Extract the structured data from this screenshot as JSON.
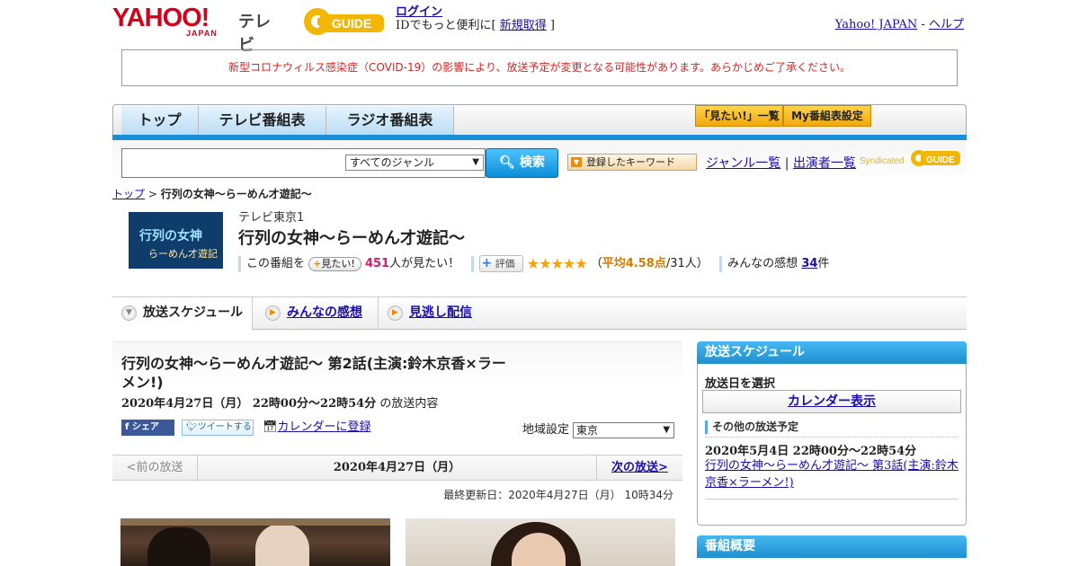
{
  "header": {
    "logo_text": "YAHOO!",
    "logo_sub": "JAPAN",
    "logo_tv": "テレビ",
    "gguide_text": "GUIDE",
    "login_label": "ログイン",
    "id_text_before": "IDでもっと便利に[ ",
    "register_label": "新規取得",
    "id_text_after": " ]",
    "yahoo_japan_link": "Yahoo! JAPAN",
    "separator": " - ",
    "help_link": "ヘルプ"
  },
  "notice": "新型コロナウィルス感染症（COVID-19）の影響により、放送予定が変更となる可能性があります。あらかじめご了承ください。",
  "nav": {
    "tabs": [
      "トップ",
      "テレビ番組表",
      "ラジオ番組表"
    ],
    "mitai_list": "「見たい!」一覧",
    "my_settings": "My番組表設定"
  },
  "search": {
    "genre_selected": "すべてのジャンル",
    "search_button": "検索",
    "keyword_button": "登録したキーワード",
    "genre_list_link": "ジャンル一覧",
    "divider": "|",
    "performer_list_link": "出演者一覧",
    "syndicated_text": "Syndicated",
    "syndicated_logo": "GUIDE"
  },
  "breadcrumb": {
    "top": "トップ",
    "sep": " > ",
    "current": "行列の女神～らーめん才遊記～"
  },
  "program": {
    "image_title": "行列の女神",
    "image_sub": "らーめん才遊記",
    "channel": "テレビ東京1",
    "title": "行列の女神～らーめん才遊記～",
    "want_prefix": "この番組を",
    "want_button": "見たい!",
    "want_count": "451",
    "want_suffix": "人が見たい！",
    "rating_button": "評価",
    "stars": "★★★★★",
    "rating_open": "（",
    "rating_avg": "平均4.58点",
    "rating_count": "/31人）",
    "comments_label": "みんなの感想",
    "comments_count": "34",
    "comments_suffix": "件"
  },
  "subtabs": [
    "放送スケジュール",
    "みんなの感想",
    "見逃し配信"
  ],
  "episode": {
    "title": "行列の女神～らーめん才遊記～ 第2話(主演:鈴木京香×ラーメン!)",
    "datetime": "2020年4月27日（月） 22時00分～22時54分",
    "datetime_suffix": " の放送内容",
    "share_fb": "シェア",
    "share_tw": "ツイートする",
    "calendar_register": "カレンダーに登録",
    "region_label": "地域設定",
    "region_value": "東京",
    "prev_broadcast": "<前の放送",
    "current_date": "2020年4月27日（月）",
    "next_broadcast": "次の放送>",
    "last_updated": "最終更新日：2020年4月27日（月） 10時34分"
  },
  "sidebar": {
    "schedule_title": "放送スケジュール",
    "select_date": "放送日を選択",
    "calendar_button": "カレンダー表示",
    "other_heading": "その他の放送予定",
    "other_date": "2020年5月4日 22時00分～22時54分",
    "other_link": "行列の女神～らーめん才遊記～ 第3話(主演:鈴木京香×ラーメン!)",
    "overview_title": "番組概要"
  },
  "colors": {
    "accent_blue": "#1a8fd6",
    "notice_red": "#d22222",
    "star_orange": "#f3a20c"
  }
}
